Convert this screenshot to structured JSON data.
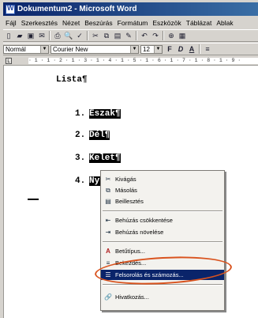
{
  "window": {
    "title": "Dokumentum2 - Microsoft Word"
  },
  "menubar": [
    "Fájl",
    "Szerkesztés",
    "Nézet",
    "Beszúrás",
    "Formátum",
    "Eszközök",
    "Táblázat",
    "Ablak"
  ],
  "formatting": {
    "style": "Normál",
    "font": "Courier New",
    "size": "12",
    "bold": "F",
    "italic": "D",
    "underline": "A"
  },
  "ruler": {
    "text": "· 1 · 1 · 2 · 1 · 3 · 1 · 4 · 1 · 5 · 1 · 6 · 1 · 7 · 1 · 8 · 1 · 9 ·"
  },
  "document": {
    "heading": "Lista¶",
    "items": [
      {
        "num": "1.",
        "text": "Észak¶"
      },
      {
        "num": "2.",
        "text": "Dél¶"
      },
      {
        "num": "3.",
        "text": "Kelet¶"
      },
      {
        "num": "4.",
        "text": "Nyu"
      }
    ]
  },
  "context_menu": {
    "items": [
      {
        "label": "Kivágás",
        "icon": "scissors-icon",
        "glyph": "✂"
      },
      {
        "label": "Másolás",
        "icon": "copy-icon",
        "glyph": "⧉"
      },
      {
        "label": "Beillesztés",
        "icon": "paste-icon",
        "glyph": "▤"
      },
      {
        "label": "Behúzás csökkentése",
        "icon": "decrease-indent-icon",
        "glyph": "⇤"
      },
      {
        "label": "Behúzás növelése",
        "icon": "increase-indent-icon",
        "glyph": "⇥"
      },
      {
        "label": "Betűtípus...",
        "icon": "font-icon",
        "glyph": "A"
      },
      {
        "label": "Bekezdés...",
        "icon": "paragraph-icon",
        "glyph": "≡"
      },
      {
        "label": "Felsorolás és számozás...",
        "icon": "bullets-numbering-icon",
        "glyph": "☰"
      },
      {
        "label": "Hivatkozás...",
        "icon": "hyperlink-icon",
        "glyph": "🔗"
      }
    ]
  },
  "colors": {
    "titlebar": "#0a246a",
    "highlight_ring": "#d9531e",
    "menu_selected": "#0a246a"
  }
}
